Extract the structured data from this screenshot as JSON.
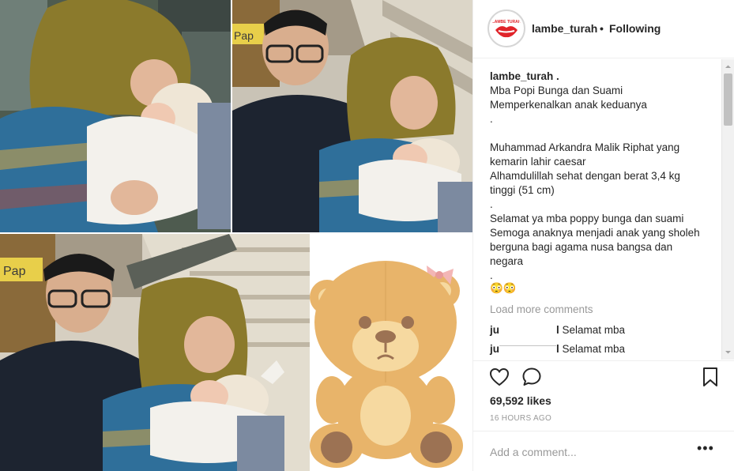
{
  "post": {
    "username": "lambe_turah",
    "separator": "•",
    "follow_status": "Following",
    "avatar_logo_text": "LAMBE TURAH"
  },
  "caption": {
    "username": "lambe_turah .",
    "lines": [
      "Mba Popi Bunga dan Suami",
      "Memperkenalkan anak keduanya",
      ".",
      "Muhammad Arkandra Malik Riphat yang",
      "kemarin lahir caesar",
      "Alhamdulillah sehat dengan berat 3,4 kg",
      "tinggi (51 cm)",
      ".",
      "Selamat ya mba poppy bunga dan suami",
      "Semoga anaknya menjadi anak yang sholeh",
      "berguna bagi agama nusa bangsa dan",
      "negara",
      ".",
      "😳😳"
    ]
  },
  "comments": {
    "load_more": "Load more comments",
    "items": [
      {
        "user_prefix": "ju",
        "user_suffix": "l",
        "text": "Selamat mba"
      },
      {
        "user_prefix": "ju",
        "user_suffix": "l",
        "text": "Selamat mba"
      }
    ]
  },
  "actions": {
    "likes": "69,592 likes",
    "time_ago": "16 HOURS AGO",
    "add_comment_placeholder": "Add a comment...",
    "more_label": "•••"
  },
  "photo_overlay_text": {
    "store_sign": "Pap"
  },
  "colors": {
    "brand_red": "#e0242a",
    "hijab_olive": "#8b7a2c",
    "batik_blue": "#2f6f9a",
    "shirt_navy": "#1d2430",
    "bear_tan": "#e8b46a",
    "bear_light": "#f6d9a0",
    "bear_paw": "#9c7253",
    "bow_pink": "#f3b6b6"
  },
  "icons": {
    "like": "heart-outline-icon",
    "comment": "speech-bubble-icon",
    "save": "bookmark-outline-icon",
    "more": "ellipsis-icon"
  }
}
